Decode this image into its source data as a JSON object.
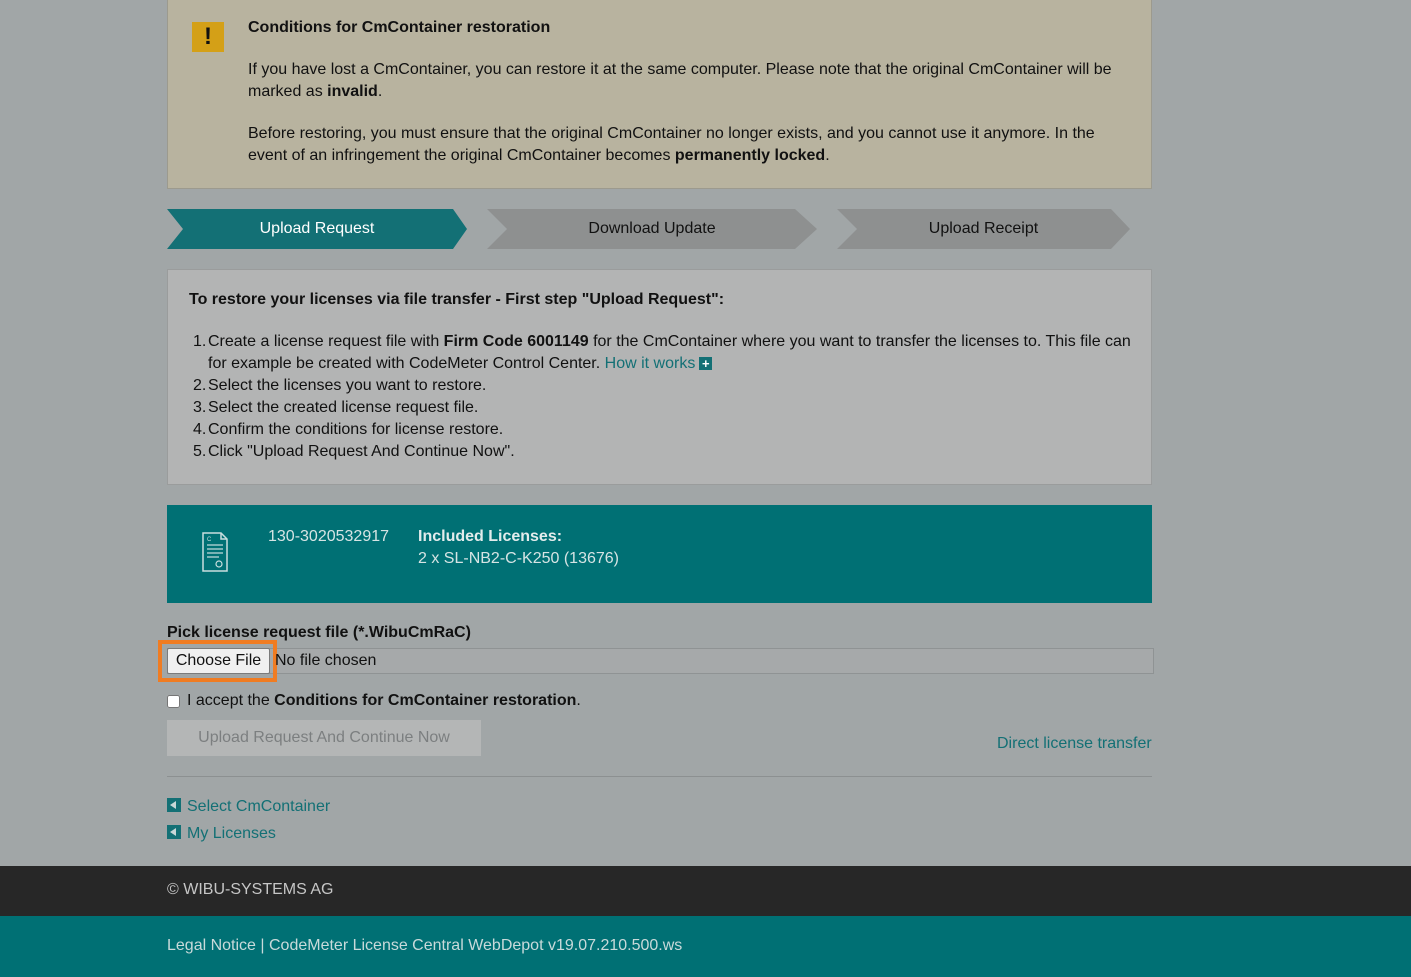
{
  "warning": {
    "title": "Conditions for CmContainer restoration",
    "p1_a": "If you have lost a CmContainer, you can restore it at the same computer. Please note that the original CmContainer will be marked as ",
    "p1_b": "invalid",
    "p1_c": ".",
    "p2_a": "Before restoring, you must ensure that the original CmContainer no longer exists, and you cannot use it anymore. In the event of an infringement the original CmContainer becomes ",
    "p2_b": "permanently locked",
    "p2_c": "."
  },
  "steps": [
    {
      "label": "Upload Request",
      "active": true
    },
    {
      "label": "Download Update",
      "active": false
    },
    {
      "label": "Upload Receipt",
      "active": false
    }
  ],
  "instructions": {
    "title": "To restore your licenses via file transfer - First step \"Upload Request\":",
    "item1_a": "Create a license request file with ",
    "item1_b": "Firm Code 6001149",
    "item1_c": " for the CmContainer where you want to transfer the licenses to. This file can for example be created with CodeMeter Control Center. ",
    "item1_link": "How it works",
    "item2": "Select the licenses you want to restore.",
    "item3": "Select the created license request file.",
    "item4": "Confirm the conditions for license restore.",
    "item5": "Click \"Upload Request And Continue Now\".",
    "numbers": [
      "1.",
      "2.",
      "3.",
      "4.",
      "5."
    ]
  },
  "license": {
    "serial": "130-3020532917",
    "included_title": "Included Licenses:",
    "included_value": "2 x SL-NB2-C-K250 (13676)"
  },
  "file_pick": {
    "label": "Pick license request file (*.WibuCmRaC)",
    "button": "Choose File",
    "status": "No file chosen"
  },
  "accept": {
    "text_a": "I accept the ",
    "text_b": "Conditions for CmContainer restoration",
    "text_c": ".",
    "checked": false
  },
  "submit_label": "Upload Request And Continue Now",
  "direct_link": "Direct license transfer",
  "back_links": [
    "Select CmContainer",
    "My Licenses"
  ],
  "footer": {
    "copyright": "© WIBU-SYSTEMS AG",
    "links": "Legal Notice | CodeMeter License Central WebDepot v19.07.210.500.ws"
  },
  "colors": {
    "teal": "#007074",
    "highlight": "#f07c22",
    "warning_icon": "#d4a017"
  }
}
